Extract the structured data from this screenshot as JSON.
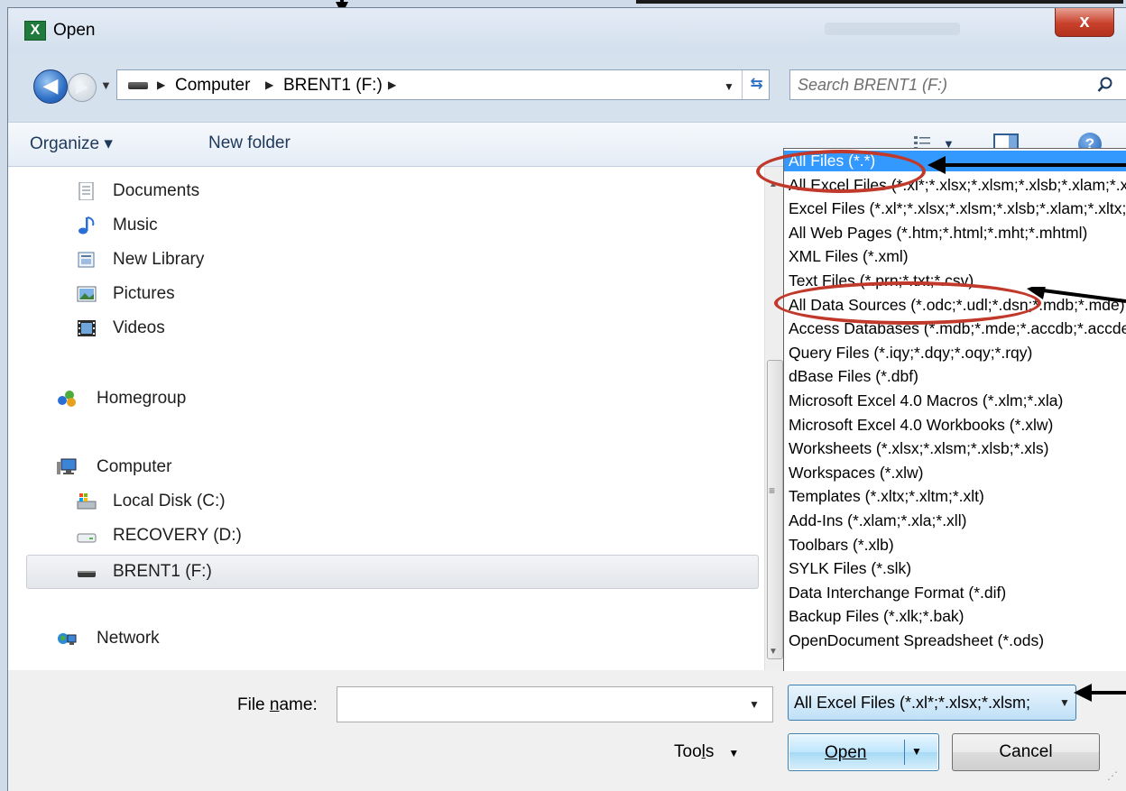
{
  "window": {
    "title": "Open",
    "app_icon": "X",
    "close_label": "x"
  },
  "address": {
    "crumbs": [
      "Computer",
      "BRENT1 (F:)"
    ],
    "search_placeholder": "Search BRENT1 (F:)"
  },
  "toolbar": {
    "organize_label": "Organize ▾",
    "new_folder_label": "New folder",
    "help_label": "?"
  },
  "nav": {
    "items": [
      {
        "label": "Documents",
        "icon": "documents-icon"
      },
      {
        "label": "Music",
        "icon": "music-icon"
      },
      {
        "label": "New Library",
        "icon": "library-icon"
      },
      {
        "label": "Pictures",
        "icon": "pictures-icon"
      },
      {
        "label": "Videos",
        "icon": "videos-icon"
      },
      {
        "label": "Homegroup",
        "icon": "homegroup-icon"
      },
      {
        "label": "Computer",
        "icon": "computer-icon"
      },
      {
        "label": "Local Disk (C:)",
        "icon": "local-disk-icon"
      },
      {
        "label": "RECOVERY (D:)",
        "icon": "drive-icon"
      },
      {
        "label": "BRENT1 (F:)",
        "icon": "usb-drive-icon",
        "selected": true
      },
      {
        "label": "Network",
        "icon": "network-icon"
      }
    ]
  },
  "file_types": {
    "options": [
      "All Files (*.*)",
      "All Excel Files (*.xl*;*.xlsx;*.xlsm;*.xlsb;*.xlam;*.xltx;*.xltm;*.xls;*.xla)",
      "Excel Files (*.xl*;*.xlsx;*.xlsm;*.xlsb;*.xlam;*.xltx;*.xltm)",
      "All Web Pages (*.htm;*.html;*.mht;*.mhtml)",
      "XML Files (*.xml)",
      "Text Files (*.prn;*.txt;*.csv)",
      "All Data Sources (*.odc;*.udl;*.dsn;*.mdb;*.mde)",
      "Access Databases (*.mdb;*.mde;*.accdb;*.accde)",
      "Query Files (*.iqy;*.dqy;*.oqy;*.rqy)",
      "dBase Files (*.dbf)",
      "Microsoft Excel 4.0 Macros (*.xlm;*.xla)",
      "Microsoft Excel 4.0 Workbooks (*.xlw)",
      "Worksheets (*.xlsx;*.xlsm;*.xlsb;*.xls)",
      "Workspaces (*.xlw)",
      "Templates (*.xltx;*.xltm;*.xlt)",
      "Add-Ins (*.xlam;*.xla;*.xll)",
      "Toolbars (*.xlb)",
      "SYLK Files (*.slk)",
      "Data Interchange Format (*.dif)",
      "Backup Files (*.xlk;*.bak)",
      "OpenDocument Spreadsheet (*.ods)"
    ],
    "highlighted_index": 0,
    "current_value": "All Excel Files (*.xl*;*.xlsx;*.xlsm;"
  },
  "bottom": {
    "file_name_label_pre": "File ",
    "file_name_label_u": "n",
    "file_name_label_post": "ame:",
    "file_name_value": "",
    "tools_label_pre": "Too",
    "tools_label_u": "l",
    "tools_label_post": "s",
    "open_label": "Open",
    "cancel_label": "Cancel"
  },
  "colors": {
    "selection": "#3399ff",
    "annotation_ring": "#c0392b",
    "accent": "#3c7fb1"
  }
}
